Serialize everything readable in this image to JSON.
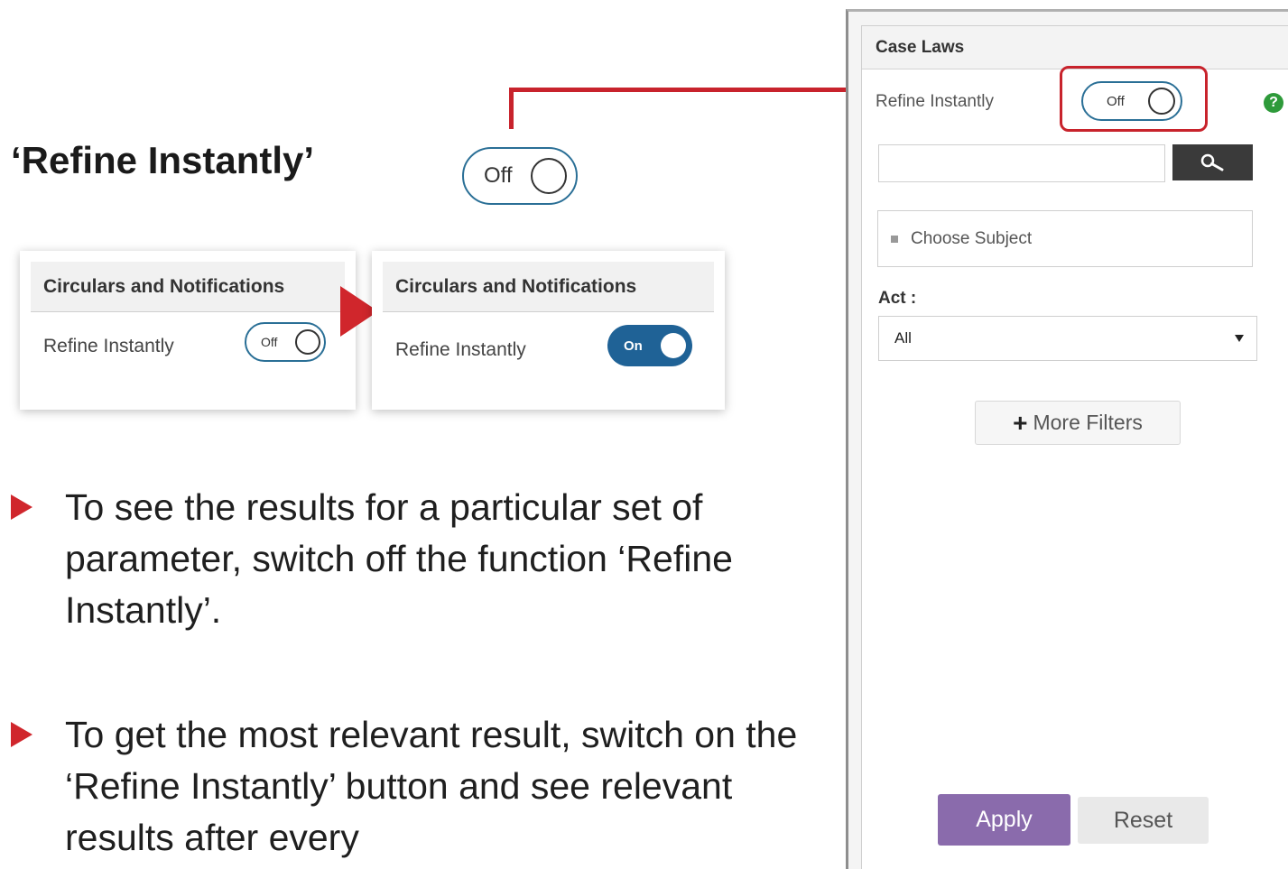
{
  "title": "‘Refine Instantly’",
  "big_toggle": {
    "label": "Off"
  },
  "panel_before": {
    "header": "Circulars and Notifications",
    "label": "Refine Instantly",
    "toggle_label": "Off"
  },
  "panel_after": {
    "header": "Circulars and Notifications",
    "label": "Refine Instantly",
    "toggle_label": "On"
  },
  "bullets": [
    "To see the results for a particular set of parameter, switch off the function ‘Refine Instantly’.",
    "To get the most relevant result, switch on the ‘Refine Instantly’ button and see relevant results after every"
  ],
  "sidebar": {
    "header": "Case Laws",
    "refine_label": "Refine Instantly",
    "toggle_label": "Off",
    "help_icon": "?",
    "search_placeholder": "",
    "subject_placeholder": "Choose Subject",
    "act_label": "Act :",
    "act_value": "All",
    "more_filters_label": "More Filters",
    "apply_label": "Apply",
    "reset_label": "Reset"
  },
  "colors": {
    "accent_red": "#c8232c",
    "toggle_blue": "#1f6296",
    "apply_purple": "#8a6bac",
    "help_green": "#2e9a3a"
  }
}
